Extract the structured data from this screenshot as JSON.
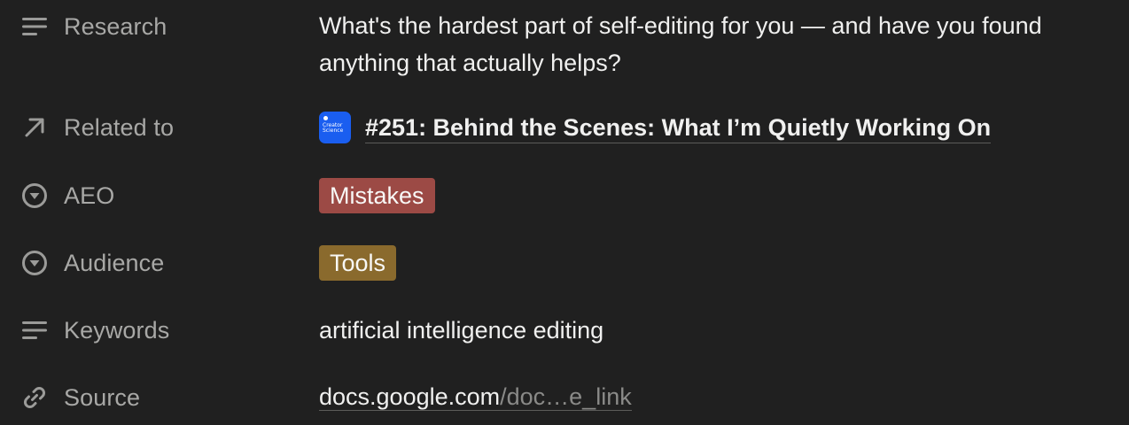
{
  "properties": [
    {
      "key": "research",
      "label": "Research",
      "icon": "text-lines-icon",
      "value": "What's the hardest part of self-editing for you — and have you found anything that actually helps?"
    },
    {
      "key": "related",
      "label": "Related to",
      "icon": "arrow-up-right-icon",
      "value": "#251: Behind the Scenes: What I’m Quietly Working On",
      "thumb_text": "Creator Science"
    },
    {
      "key": "aeo",
      "label": "AEO",
      "icon": "select-circle-icon",
      "value": "Mistakes",
      "tag_color": "#9c4a45"
    },
    {
      "key": "audience",
      "label": "Audience",
      "icon": "select-circle-icon",
      "value": "Tools",
      "tag_color": "#8a6a2d"
    },
    {
      "key": "keywords",
      "label": "Keywords",
      "icon": "text-lines-icon",
      "value": "artificial intelligence editing"
    },
    {
      "key": "source",
      "label": "Source",
      "icon": "link-icon",
      "domain": "docs.google.com",
      "path": "/doc…e_link"
    }
  ],
  "colors": {
    "background": "#202020",
    "label": "#a8a8a6",
    "value": "#f0f0ef",
    "thumb_bg": "#1a5ef0"
  }
}
